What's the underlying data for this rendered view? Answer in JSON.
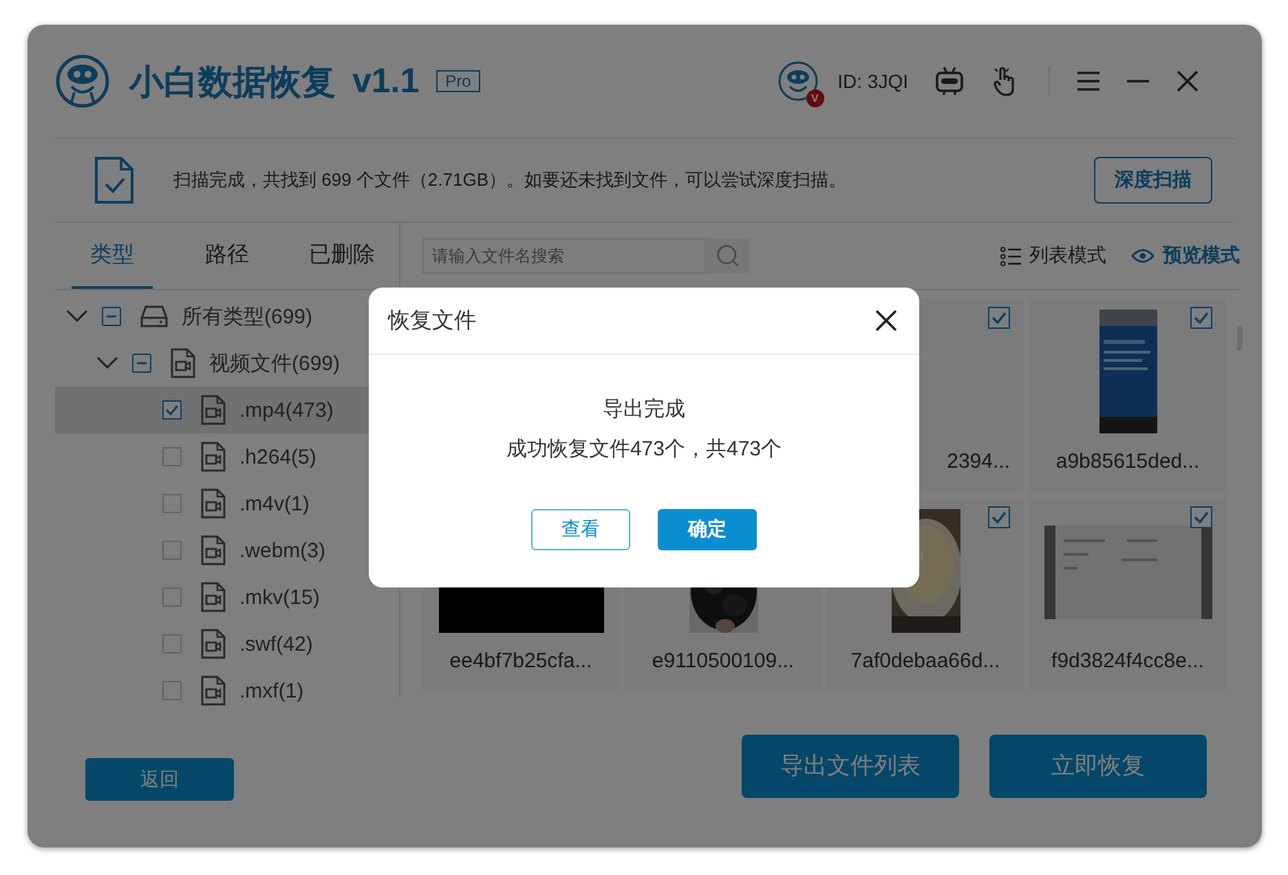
{
  "header": {
    "title": "小白数据恢复",
    "version": "v1.1",
    "edition": "Pro",
    "avatar_badge": "V",
    "user_id": "ID: 3JQI"
  },
  "info_bar": {
    "message": "扫描完成，共找到 699 个文件（2.71GB）。如要还未找到文件，可以尝试深度扫描。",
    "deep_scan_button": "深度扫描"
  },
  "tabs": [
    {
      "label": "类型",
      "selected": true
    },
    {
      "label": "路径",
      "selected": false
    },
    {
      "label": "已删除",
      "selected": false
    }
  ],
  "tree": [
    {
      "label": "所有类型(699)",
      "kind": "drive",
      "expanded": true,
      "indeterminate": true,
      "selected": false,
      "children": [
        {
          "label": "视频文件(699)",
          "kind": "video",
          "expanded": true,
          "indeterminate": true,
          "selected": false,
          "children": [
            {
              "label": ".mp4(473)",
              "kind": "video",
              "checked": true,
              "indeterminate": false,
              "selected": true
            },
            {
              "label": ".h264(5)",
              "kind": "video",
              "checked": false,
              "indeterminate": false,
              "selected": false
            },
            {
              "label": ".m4v(1)",
              "kind": "video",
              "checked": false,
              "indeterminate": false,
              "selected": false
            },
            {
              "label": ".webm(3)",
              "kind": "video",
              "checked": false,
              "indeterminate": false,
              "selected": false
            },
            {
              "label": ".mkv(15)",
              "kind": "video",
              "checked": false,
              "indeterminate": false,
              "selected": false
            },
            {
              "label": ".swf(42)",
              "kind": "video",
              "checked": false,
              "indeterminate": false,
              "selected": false
            },
            {
              "label": ".mxf(1)",
              "kind": "video",
              "checked": false,
              "indeterminate": false,
              "selected": false
            }
          ]
        }
      ]
    }
  ],
  "search": {
    "placeholder": "请输入文件名搜索"
  },
  "view_modes": [
    {
      "label": "列表模式",
      "kind": "list",
      "selected": false
    },
    {
      "label": "预览模式",
      "kind": "preview",
      "selected": true
    }
  ],
  "grid": {
    "rows": [
      [
        "",
        "",
        {
          "kind": "partial",
          "name": "2394...",
          "checked": true
        },
        {
          "kind": "file",
          "name": "a9b85615ded...",
          "checked": true
        }
      ],
      [
        {
          "kind": "file",
          "name": "ee4bf7b25cfa..."
        },
        {
          "kind": "file",
          "name": "e9110500109..."
        },
        {
          "kind": "file",
          "name": "7af0debaa66d...",
          "checked": true
        },
        {
          "kind": "file",
          "name": "f9d3824f4cc8e...",
          "checked": true
        }
      ]
    ]
  },
  "footer": {
    "back_button": "返回",
    "export_list_button": "导出文件列表",
    "recover_button": "立即恢复"
  },
  "dialog": {
    "title": "恢复文件",
    "heading": "导出完成",
    "message": "成功恢复文件473个，共473个",
    "view_button": "查看",
    "ok_button": "确定"
  }
}
